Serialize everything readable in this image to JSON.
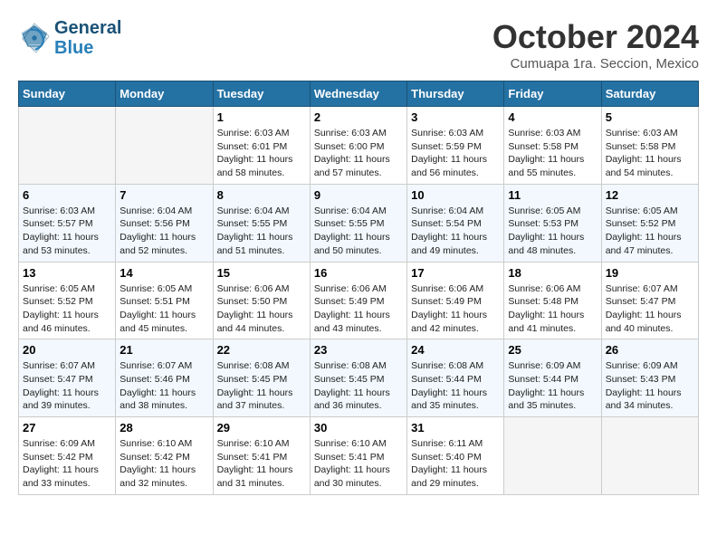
{
  "header": {
    "logo_line1": "General",
    "logo_line2": "Blue",
    "month": "October 2024",
    "location": "Cumuapa 1ra. Seccion, Mexico"
  },
  "weekdays": [
    "Sunday",
    "Monday",
    "Tuesday",
    "Wednesday",
    "Thursday",
    "Friday",
    "Saturday"
  ],
  "weeks": [
    [
      {
        "day": "",
        "info": ""
      },
      {
        "day": "",
        "info": ""
      },
      {
        "day": "1",
        "sunrise": "6:03 AM",
        "sunset": "6:01 PM",
        "daylight": "11 hours and 58 minutes."
      },
      {
        "day": "2",
        "sunrise": "6:03 AM",
        "sunset": "6:00 PM",
        "daylight": "11 hours and 57 minutes."
      },
      {
        "day": "3",
        "sunrise": "6:03 AM",
        "sunset": "5:59 PM",
        "daylight": "11 hours and 56 minutes."
      },
      {
        "day": "4",
        "sunrise": "6:03 AM",
        "sunset": "5:58 PM",
        "daylight": "11 hours and 55 minutes."
      },
      {
        "day": "5",
        "sunrise": "6:03 AM",
        "sunset": "5:58 PM",
        "daylight": "11 hours and 54 minutes."
      }
    ],
    [
      {
        "day": "6",
        "sunrise": "6:03 AM",
        "sunset": "5:57 PM",
        "daylight": "11 hours and 53 minutes."
      },
      {
        "day": "7",
        "sunrise": "6:04 AM",
        "sunset": "5:56 PM",
        "daylight": "11 hours and 52 minutes."
      },
      {
        "day": "8",
        "sunrise": "6:04 AM",
        "sunset": "5:55 PM",
        "daylight": "11 hours and 51 minutes."
      },
      {
        "day": "9",
        "sunrise": "6:04 AM",
        "sunset": "5:55 PM",
        "daylight": "11 hours and 50 minutes."
      },
      {
        "day": "10",
        "sunrise": "6:04 AM",
        "sunset": "5:54 PM",
        "daylight": "11 hours and 49 minutes."
      },
      {
        "day": "11",
        "sunrise": "6:05 AM",
        "sunset": "5:53 PM",
        "daylight": "11 hours and 48 minutes."
      },
      {
        "day": "12",
        "sunrise": "6:05 AM",
        "sunset": "5:52 PM",
        "daylight": "11 hours and 47 minutes."
      }
    ],
    [
      {
        "day": "13",
        "sunrise": "6:05 AM",
        "sunset": "5:52 PM",
        "daylight": "11 hours and 46 minutes."
      },
      {
        "day": "14",
        "sunrise": "6:05 AM",
        "sunset": "5:51 PM",
        "daylight": "11 hours and 45 minutes."
      },
      {
        "day": "15",
        "sunrise": "6:06 AM",
        "sunset": "5:50 PM",
        "daylight": "11 hours and 44 minutes."
      },
      {
        "day": "16",
        "sunrise": "6:06 AM",
        "sunset": "5:49 PM",
        "daylight": "11 hours and 43 minutes."
      },
      {
        "day": "17",
        "sunrise": "6:06 AM",
        "sunset": "5:49 PM",
        "daylight": "11 hours and 42 minutes."
      },
      {
        "day": "18",
        "sunrise": "6:06 AM",
        "sunset": "5:48 PM",
        "daylight": "11 hours and 41 minutes."
      },
      {
        "day": "19",
        "sunrise": "6:07 AM",
        "sunset": "5:47 PM",
        "daylight": "11 hours and 40 minutes."
      }
    ],
    [
      {
        "day": "20",
        "sunrise": "6:07 AM",
        "sunset": "5:47 PM",
        "daylight": "11 hours and 39 minutes."
      },
      {
        "day": "21",
        "sunrise": "6:07 AM",
        "sunset": "5:46 PM",
        "daylight": "11 hours and 38 minutes."
      },
      {
        "day": "22",
        "sunrise": "6:08 AM",
        "sunset": "5:45 PM",
        "daylight": "11 hours and 37 minutes."
      },
      {
        "day": "23",
        "sunrise": "6:08 AM",
        "sunset": "5:45 PM",
        "daylight": "11 hours and 36 minutes."
      },
      {
        "day": "24",
        "sunrise": "6:08 AM",
        "sunset": "5:44 PM",
        "daylight": "11 hours and 35 minutes."
      },
      {
        "day": "25",
        "sunrise": "6:09 AM",
        "sunset": "5:44 PM",
        "daylight": "11 hours and 35 minutes."
      },
      {
        "day": "26",
        "sunrise": "6:09 AM",
        "sunset": "5:43 PM",
        "daylight": "11 hours and 34 minutes."
      }
    ],
    [
      {
        "day": "27",
        "sunrise": "6:09 AM",
        "sunset": "5:42 PM",
        "daylight": "11 hours and 33 minutes."
      },
      {
        "day": "28",
        "sunrise": "6:10 AM",
        "sunset": "5:42 PM",
        "daylight": "11 hours and 32 minutes."
      },
      {
        "day": "29",
        "sunrise": "6:10 AM",
        "sunset": "5:41 PM",
        "daylight": "11 hours and 31 minutes."
      },
      {
        "day": "30",
        "sunrise": "6:10 AM",
        "sunset": "5:41 PM",
        "daylight": "11 hours and 30 minutes."
      },
      {
        "day": "31",
        "sunrise": "6:11 AM",
        "sunset": "5:40 PM",
        "daylight": "11 hours and 29 minutes."
      },
      {
        "day": "",
        "info": ""
      },
      {
        "day": "",
        "info": ""
      }
    ]
  ]
}
